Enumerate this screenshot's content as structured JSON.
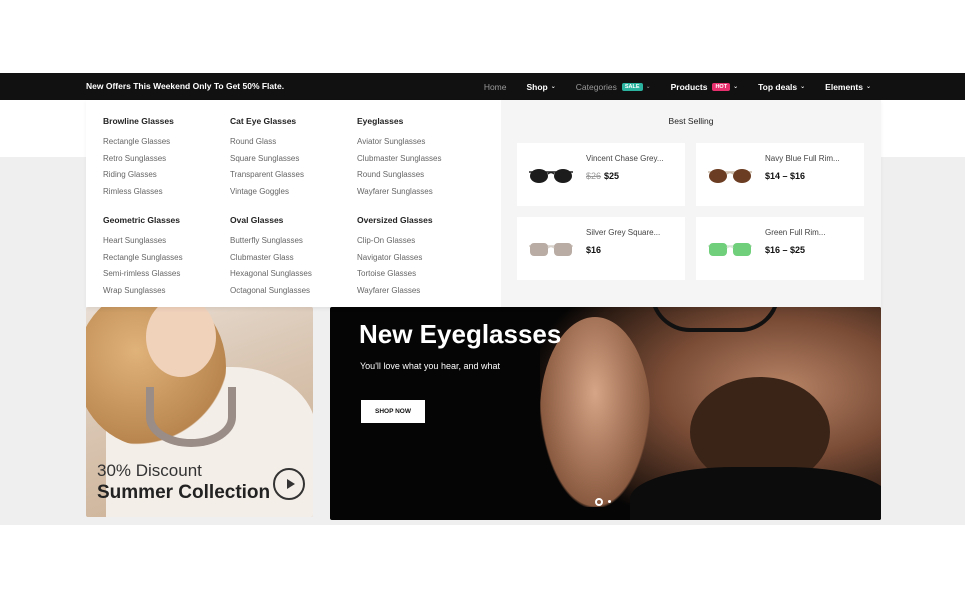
{
  "topbar": {
    "offer": "New Offers This Weekend Only To Get 50% Flate.",
    "nav": [
      {
        "label": "Home",
        "badge": "",
        "chevron": false
      },
      {
        "label": "Shop",
        "badge": "",
        "chevron": true
      },
      {
        "label": "Categories",
        "badge": "SALE",
        "chevron": true
      },
      {
        "label": "Products",
        "badge": "HOT",
        "chevron": true
      },
      {
        "label": "Top deals",
        "badge": "",
        "chevron": true
      },
      {
        "label": "Elements",
        "badge": "",
        "chevron": true
      }
    ],
    "badge_colors": {
      "sale": "#2bb3a0",
      "hot": "#e8306e"
    }
  },
  "megamenu": {
    "columns": [
      {
        "title": "Browline Glasses",
        "items": [
          "Rectangle Glasses",
          "Retro Sunglasses",
          "Riding Glasses",
          "Rimless Glasses"
        ]
      },
      {
        "title": "Cat Eye Glasses",
        "items": [
          "Round Glass",
          "Square Sunglasses",
          "Transparent Glasses",
          "Vintage Goggles"
        ]
      },
      {
        "title": "Eyeglasses",
        "items": [
          "Aviator Sunglasses",
          "Clubmaster Sunglasses",
          "Round Sunglasses",
          "Wayfarer Sunglasses"
        ]
      },
      {
        "title": "Geometric Glasses",
        "items": [
          "Heart Sunglasses",
          "Rectangle Sunglasses",
          "Semi-rimless Glasses",
          "Wrap Sunglasses"
        ]
      },
      {
        "title": "Oval Glasses",
        "items": [
          "Butterfly Sunglasses",
          "Clubmaster Glass",
          "Hexagonal Sunglasses",
          "Octagonal Sunglasses"
        ]
      },
      {
        "title": "Oversized Glasses",
        "items": [
          "Clip-On Glasses",
          "Navigator Glasses",
          "Tortoise Glasses",
          "Wayfarer Glasses"
        ]
      }
    ],
    "best_selling": {
      "title": "Best Selling",
      "products": [
        {
          "name": "Vincent Chase Grey...",
          "old_price": "$26",
          "price": "$25",
          "lens_color": "#1c1c1c"
        },
        {
          "name": "Navy Blue Full Rim...",
          "old_price": "",
          "price": "$14 – $16",
          "lens_color": "#6b3d22"
        },
        {
          "name": "Silver Grey Square...",
          "old_price": "",
          "price": "$16",
          "lens_color": "#b9aca4"
        },
        {
          "name": "Green Full Rim...",
          "old_price": "",
          "price": "$16 – $25",
          "lens_color": "#6fcf7a"
        }
      ]
    }
  },
  "promo": {
    "line1": "30% Discount",
    "line2": "Summer Collection"
  },
  "hero": {
    "title": "New Eyeglasses",
    "subtitle": "You'll love what you hear, and what",
    "button": "SHOP NOW"
  }
}
